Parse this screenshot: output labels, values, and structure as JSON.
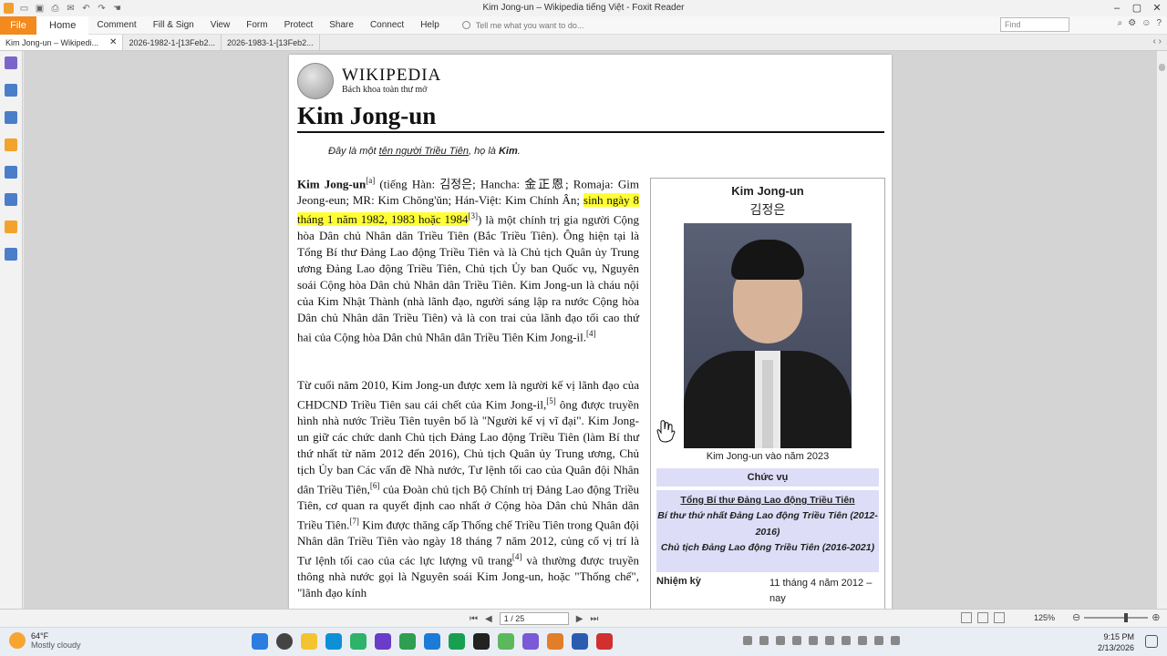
{
  "window": {
    "title": "Kim Jong-un – Wikipedia tiếng Việt - Foxit Reader"
  },
  "menu": {
    "file": "File",
    "items": [
      "Home",
      "Comment",
      "Fill & Sign",
      "View",
      "Form",
      "Protect",
      "Share",
      "Connect",
      "Help"
    ],
    "tell_me": "Tell me what you want to do...",
    "find_placeholder": "Find"
  },
  "tabs": [
    {
      "label": "Kim Jong-un – Wikipedi..."
    },
    {
      "label": "2026-1982-1-[13Feb2..."
    },
    {
      "label": "2026-1983-1-[13Feb2..."
    }
  ],
  "wiki": {
    "logo_name": "WIKIPEDIA",
    "tagline": "Bách khoa toàn thư mở",
    "title": "Kim Jong-un"
  },
  "hatnote": {
    "pre": "Đây là một ",
    "link": "tên người Triều Tiên",
    "mid": ", họ là ",
    "bold": "Kim",
    "end": "."
  },
  "article": {
    "p1": {
      "name": "Kim Jong-un",
      "note_a": "[a]",
      "part1": " (tiếng Hàn: 김정은; Hancha: 金正恩; Romaja: Gim Jeong-eun; MR: Kim Chŏng'ŭn; Hán-Việt: Kim Chính Ân; ",
      "highlight": "sinh ngày 8 tháng 1 năm 1982, 1983 hoặc 1984",
      "ref3": "[3]",
      "part2": ") là một chính trị gia người Cộng hòa Dân chủ Nhân dân Triều Tiên (Bắc Triều Tiên). Ông hiện tại là Tổng Bí thư Đảng Lao động Triều Tiên và là Chủ tịch Quân ủy Trung ương Đảng Lao động Triều Tiên, Chủ tịch Ủy ban Quốc vụ, Nguyên soái Cộng hòa Dân chủ Nhân dân Triều Tiên. Kim Jong-un là cháu nội của Kim Nhật Thành (nhà lãnh đạo, người sáng lập ra nước Cộng hòa Dân chủ Nhân dân Triều Tiên) và là con trai của lãnh đạo tối cao thứ hai của Cộng hòa Dân chủ Nhân dân Triều Tiên Kim Jong-il.",
      "ref4": "[4]"
    },
    "p2": {
      "part1": "Từ cuối năm 2010, Kim Jong-un được xem là người kế vị lãnh đạo của CHDCND Triều Tiên sau cái chết của Kim Jong-il,",
      "ref5": "[5]",
      "part2": " ông được truyền hình nhà nước Triều Tiên tuyên bố là \"Người kế vị vĩ đại\". Kim Jong-un giữ các chức danh Chủ tịch Đảng Lao động Triều Tiên (làm Bí thư thứ nhất từ năm 2012 đến 2016), Chủ tịch Quân ủy Trung ương, Chủ tịch Ủy ban Các vấn đề Nhà nước, Tư lệnh tối cao của Quân đội Nhân dân Triều Tiên,",
      "ref6": "[6]",
      "part3": " của Đoàn chủ tịch Bộ Chính trị Đảng Lao động Triều Tiên, cơ quan ra quyết định cao nhất ở Cộng hòa Dân chủ Nhân dân Triều Tiên.",
      "ref7": "[7]",
      "part4": " Kim được thăng cấp Thống chế Triều Tiên trong Quân đội Nhân dân Triều Tiên vào ngày 18 tháng 7 năm 2012, củng cố vị trí là Tư lệnh tối cao của các lực lượng vũ trang",
      "ref4b": "[4]",
      "part5": " và thường được truyền thông nhà nước gọi là Nguyên soái Kim Jong-un, hoặc \"Thống chế\", \"lãnh đạo kính"
    }
  },
  "infobox": {
    "title": "Kim Jong-un",
    "korean": "김정은",
    "caption": "Kim Jong-un vào năm 2023",
    "section": "Chức vụ",
    "offices": [
      "Tổng Bí thư Đảng Lao động Triều Tiên",
      "Bí thư thứ nhất Đảng Lao động Triều Tiên (2012-2016)",
      "Chủ tịch Đảng Lao động Triều Tiên (2016-2021)"
    ],
    "term_label": "Nhiệm kỳ",
    "term_value": "11 tháng 4 năm 2012 – nay"
  },
  "status": {
    "page": "1 / 25",
    "zoom": "125%"
  },
  "taskbar": {
    "temp": "64°F",
    "weather": "Mostly cloudy",
    "time": "9:15 PM",
    "date": "2/13/2026"
  },
  "colors": {
    "accent": "#f28a1d",
    "highlight": "#ffff33",
    "infobox_band": "#ddddf7"
  }
}
